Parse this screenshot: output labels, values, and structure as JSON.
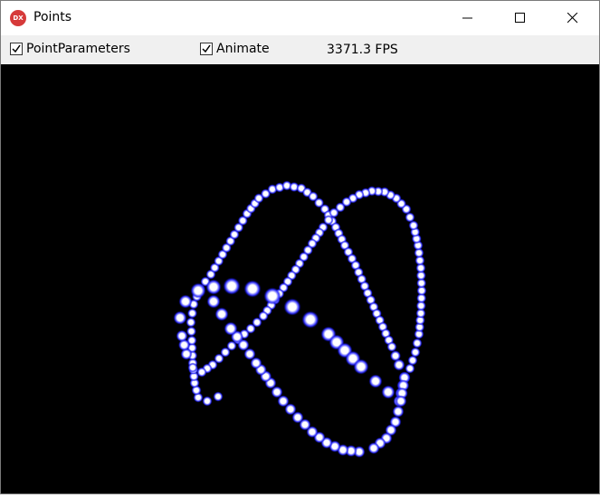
{
  "window": {
    "title": "Points",
    "icon_label": "DX"
  },
  "toolbar": {
    "point_parameters_label": "PointParameters",
    "point_parameters_checked": true,
    "animate_label": "Animate",
    "animate_checked": true,
    "fps_text": "3371.3 FPS"
  },
  "colors": {
    "point_core": "#ffffff",
    "point_glow": "#2020ff",
    "background": "#000000"
  }
}
